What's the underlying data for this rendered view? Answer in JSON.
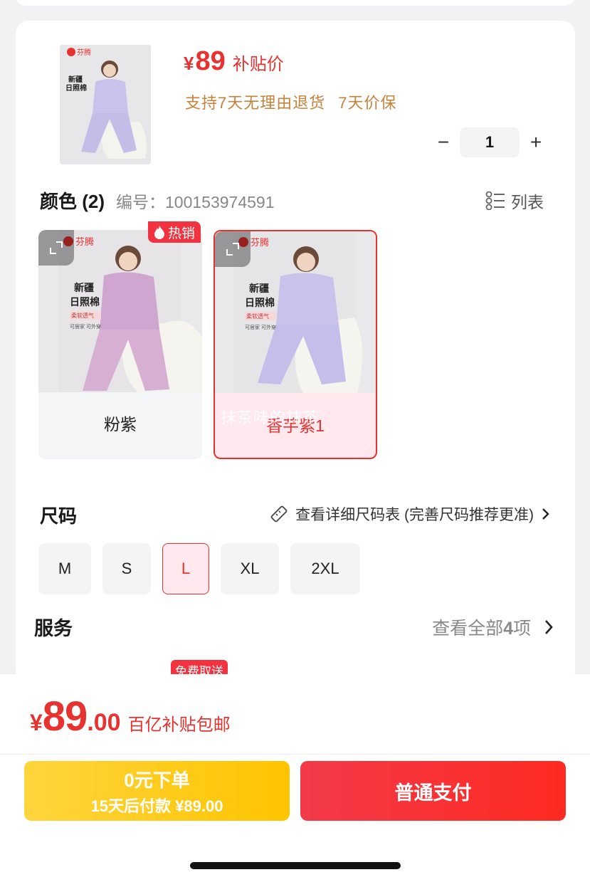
{
  "product": {
    "price_symbol": "¥",
    "price": "89",
    "price_tag": "补贴价",
    "promises": [
      "支持7天无理由退货",
      "7天价保"
    ],
    "quantity": "1",
    "minus": "−",
    "plus": "+"
  },
  "color": {
    "title": "颜色 (2)",
    "code": "编号：100153974591",
    "list_label": "列表",
    "hot_badge": "热销",
    "watermark": "抹茶味的抹茶",
    "options": [
      {
        "label": "粉紫",
        "selected": false,
        "tone": "#c9a4c9"
      },
      {
        "label": "香芋紫1",
        "selected": true,
        "tone": "#c7c2ea"
      }
    ],
    "brand": "芬腾",
    "photo_text": [
      "新疆",
      "日照棉",
      "柔软透气",
      "可居家 可外穿"
    ]
  },
  "size": {
    "title": "尺码",
    "chart_link": "查看详细尺码表 (完善尺码推荐更准)",
    "options": [
      "M",
      "S",
      "L",
      "XL",
      "2XL"
    ],
    "selected": "L"
  },
  "service": {
    "title": "服务",
    "link_prefix": "查看全部",
    "count": "4",
    "link_suffix": "项",
    "free_tag": "免费取送"
  },
  "bottom": {
    "yen": "¥",
    "int": "89",
    "dec": ".00",
    "note": "百亿补贴包邮",
    "pay_later_line1": "0元下单",
    "pay_later_line2": "15天后付款 ¥89.00",
    "pay_normal": "普通支付"
  },
  "colors": {
    "accent": "#e8322f",
    "gold": "#c5823c",
    "yellow": "#ffc400"
  }
}
